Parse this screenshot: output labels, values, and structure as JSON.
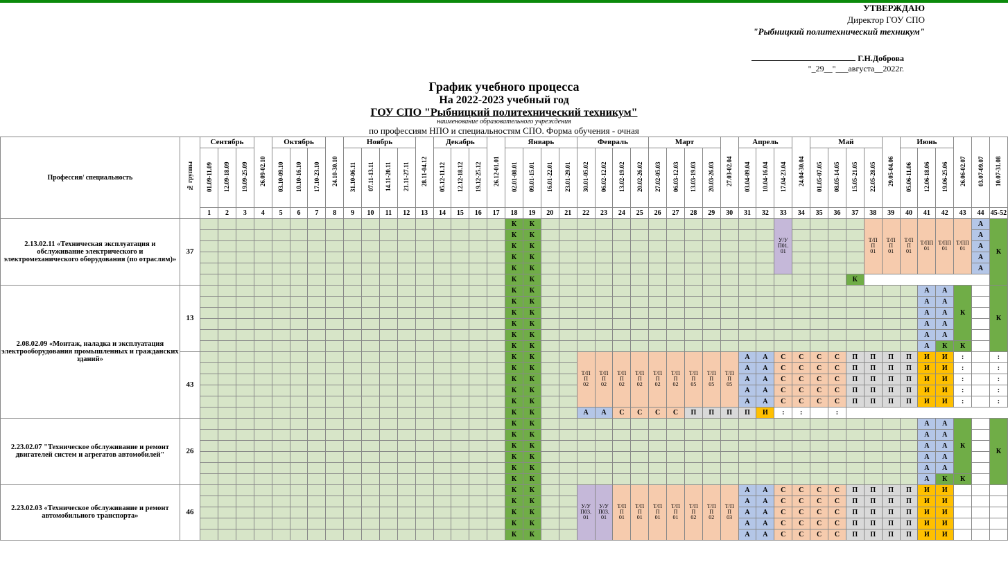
{
  "header": {
    "approve": "УТВЕРЖДАЮ",
    "director": "Директор ГОУ СПО",
    "institution": "\"Рыбницкий политехнический техникум\"",
    "name": "Г.Н.Доброва",
    "date": "\"_29__\"___августа__2022г."
  },
  "titles": {
    "t1": "График учебного процесса",
    "t2": "На 2022-2023 учебный год",
    "t3": "ГОУ  СПО \"Рыбницкий политехнический техникум\"",
    "t4": "наименование образовательного учреждения",
    "t5": "по профессиям НПО и специальностям СПО. Форма обучения - очная"
  },
  "corner": {
    "prof": "Профессия/ специальность",
    "grp": "№ группы"
  },
  "months": [
    "Сентябрь",
    "Октябрь",
    "Ноябрь",
    "Декабрь",
    "Январь",
    "Февраль",
    "Март",
    "Апрель",
    "Май",
    "Июнь"
  ],
  "month_spans": [
    3,
    4,
    4,
    4,
    4,
    4,
    4,
    4,
    4,
    4
  ],
  "lone_weeks": [
    "26.09-02.10",
    "24.10-30.10",
    "28.11-04.12",
    "26.12-01.01",
    "27.03-02.04",
    "24.04-30.04",
    "29.05-04.06",
    "26.06-02.07",
    "03.07-09.07",
    "10.07-31.08"
  ],
  "dates": [
    "01.09-11.09",
    "12.09-18.09",
    "19.09-25.09",
    "26.09-02.10",
    "03.10-09.10",
    "10.10-16.10",
    "17.10-23.10",
    "24.10-30.10",
    "31.10-06.11",
    "07.11-13.11",
    "14.11-20.11",
    "21.11-27.11",
    "28.11-04.12",
    "05.12-11.12",
    "12.12-18.12",
    "19.12-25.12",
    "26.12-01.01",
    "02.01-08.01",
    "09.01-15.01",
    "16.01-22.01",
    "23.01-29.01",
    "30.01-05.02",
    "06.02-12.02",
    "13.02-19.02",
    "20.02-26.02",
    "27.02-05.03",
    "06.03-12.03",
    "13.03-19.03",
    "20.03-26.03",
    "27.03-02.04",
    "03.04-09.04",
    "10.04-16.04",
    "17.04-23.04",
    "24.04-30.04",
    "01.05-07.05",
    "08.05-14.05",
    "15.05-21.05",
    "22.05-28.05",
    "29.05-04.06",
    "05.06-11.06",
    "12.06-18.06",
    "19.06-25.06",
    "26.06-02.07",
    "03.07-09.07",
    "10.07-31.08"
  ],
  "last_wk": "45-52",
  "rows": [
    {
      "prof": "2.13.02.11 «Техническая эксплуатация и обслуживание электрического и электромеханического оборудования (по отраслям)»",
      "grp": "37",
      "lines": 6,
      "cells": {
        "18": "kd:К",
        "19": "kd:К",
        "33": "uy:У/У П01. 01",
        "38": "tp:Т/П П 01",
        "39": "tp:Т/П П 01",
        "40": "tp:Т/П П 01",
        "41": "tp:Т/ПП 01",
        "42": "tp:Т/ПП 01",
        "43": "tp:Т/ПП 01",
        "44": "a:А",
        "45": "kd:К"
      },
      "g_range": [
        1,
        37
      ],
      "g_also": [
        20,
        21,
        22,
        23,
        24,
        25,
        26,
        27,
        28,
        29,
        30,
        31,
        32,
        34,
        35,
        36,
        37
      ],
      "special_last": {
        "44": "kd:К"
      }
    },
    {
      "prof_span_with_next": true,
      "prof": "2.08.02.09 «Монтаж, наладка и эксплуатация электрооборудования промышленных и гражданских зданий»",
      "grp": "13",
      "lines": 6,
      "cells": {
        "18": "kd:К",
        "19": "kd:К",
        "41": "a:А",
        "42": "a:А",
        "43": "kd:К",
        "45": "kd:К"
      },
      "special_last": {
        "42": "kd:К"
      }
    },
    {
      "grp": "43",
      "lines": 6,
      "cells": {
        "18": "kd:К",
        "19": "kd:К",
        "22": "tp:Т/П П 02",
        "23": "tp:Т/П П 02",
        "24": "tp:Т/П П 02",
        "25": "tp:Т/П П 02",
        "26": "tp:Т/П П 02",
        "27": "tp:Т/П П 02",
        "28": "tp:Т/П П 05",
        "29": "tp:Т/П П 05",
        "30": "tp:Т/П П 05",
        "31": "a:А",
        "32": "a:А",
        "33": "c:С",
        "34": "c:С",
        "35": "c:С",
        "36": "c:С",
        "37": "p:П",
        "38": "p:П",
        "39": "p:П",
        "40": "p:П",
        "41": "i:И",
        "42": "i:И",
        "43": "colon::",
        "45": "colon::"
      },
      "g_stop": 21,
      "special_last": {
        "42": "colon::"
      }
    },
    {
      "prof": "2.23.02.07 \"Техническое обслуживание и ремонт двигателей систем и агрегатов автомобилей\"",
      "grp": "26",
      "lines": 6,
      "cells": {
        "18": "kd:К",
        "19": "kd:К",
        "41": "a:А",
        "42": "a:А",
        "43": "kd:К",
        "45": "kd:К"
      },
      "special_last": {
        "42": "kd:К"
      }
    },
    {
      "prof": "2.23.02.03 «Техническое обслуживание и ремонт автомобильного транспорта»",
      "grp": "46",
      "lines": 5,
      "cells": {
        "18": "kd:К",
        "19": "kd:К",
        "22": "uy:У/У П03. 01",
        "23": "uy:У/У П03. 01",
        "24": "tp:Т/П П 01",
        "25": "tp:Т/П П 01",
        "26": "tp:Т/П П 01",
        "27": "tp:Т/П П 01",
        "28": "tp:Т/П П 02",
        "29": "tp:Т/П П 02",
        "30": "tp:Т/П П 03",
        "31": "a:А",
        "32": "a:А",
        "33": "c:С",
        "34": "c:С",
        "35": "c:С",
        "36": "c:С",
        "37": "p:П",
        "38": "p:П",
        "39": "p:П",
        "40": "p:П",
        "41": "i:И",
        "42": "i:И"
      },
      "g_stop": 21
    }
  ]
}
